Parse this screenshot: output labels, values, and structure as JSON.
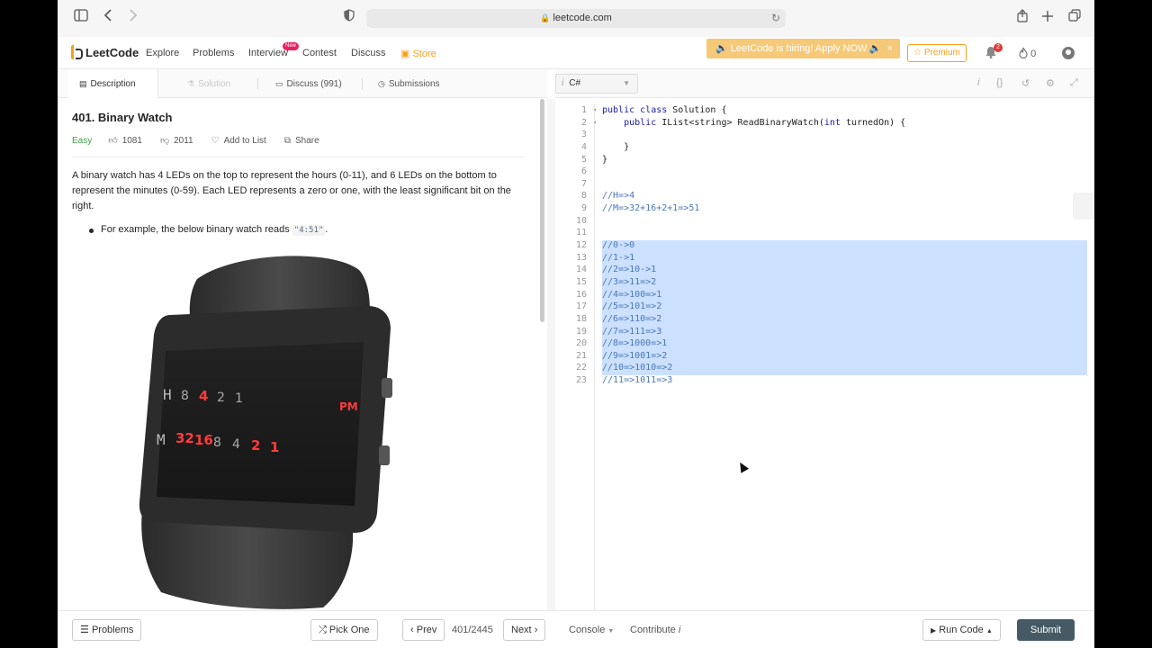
{
  "browser": {
    "url": "leetcode.com"
  },
  "nav": {
    "logo_text": "LeetCode",
    "links": [
      "Explore",
      "Problems",
      "Interview",
      "Contest",
      "Discuss"
    ],
    "new_badge": "New",
    "store": "Store",
    "hiring_banner": "🔈 LeetCode is hiring! Apply NOW.🔈",
    "hiring_close": "×",
    "premium": "☆ Premium",
    "notifications_count": "2",
    "points": "0"
  },
  "tabs": {
    "description": "Description",
    "solution": "Solution",
    "discuss": "Discuss (991)",
    "submissions": "Submissions"
  },
  "problem": {
    "title": "401. Binary Watch",
    "difficulty": "Easy",
    "likes": "1081",
    "dislikes": "2011",
    "add_to_list": "Add to List",
    "share": "Share",
    "description": "A binary watch has 4 LEDs on the top to represent the hours (0-11), and 6 LEDs on the bottom to represent the minutes (0-59). Each LED represents a zero or one, with the least significant bit on the right.",
    "bullet_prefix": "For example, the below binary watch reads ",
    "bullet_code": "\"4:51\"",
    "bullet_suffix": ".",
    "watch": {
      "hours_letter": "H",
      "minutes_letter": "M",
      "hour_leds": [
        {
          "label": "8",
          "on": false
        },
        {
          "label": "4",
          "on": true
        },
        {
          "label": "2",
          "on": false
        },
        {
          "label": "1",
          "on": false
        }
      ],
      "minute_leds": [
        {
          "label": "32",
          "on": true
        },
        {
          "label": "16",
          "on": true
        },
        {
          "label": "8",
          "on": false
        },
        {
          "label": "4",
          "on": false
        },
        {
          "label": "2",
          "on": true
        },
        {
          "label": "1",
          "on": true
        }
      ],
      "pm": "PM"
    }
  },
  "editor": {
    "language": "C#",
    "line_numbers": [
      "1",
      "2",
      "3",
      "4",
      "5",
      "6",
      "7",
      "8",
      "9",
      "10",
      "11",
      "12",
      "13",
      "14",
      "15",
      "16",
      "17",
      "18",
      "19",
      "20",
      "21",
      "22",
      "23"
    ],
    "lines": [
      "public class Solution {",
      "    public IList<string> ReadBinaryWatch(int turnedOn) {",
      "",
      "    }",
      "}",
      "",
      "",
      "//H=>4",
      "//M=>32+16+2+1=>51",
      "",
      "",
      "//0->0",
      "//1->1",
      "//2=>10->1",
      "//3=>11=>2",
      "//4=>100=>1",
      "//5=>101=>2",
      "//6=>110=>2",
      "//7=>111=>3",
      "//8=>1000=>1",
      "//9=>1001=>2",
      "//10=>1010=>2",
      "//11=>1011=>3"
    ]
  },
  "bottom": {
    "problems": "Problems",
    "pick_one": "Pick One",
    "prev": "Prev",
    "page": "401/2445",
    "next": "Next",
    "console": "Console",
    "contribute": "Contribute",
    "run_code": "Run Code",
    "submit": "Submit"
  }
}
